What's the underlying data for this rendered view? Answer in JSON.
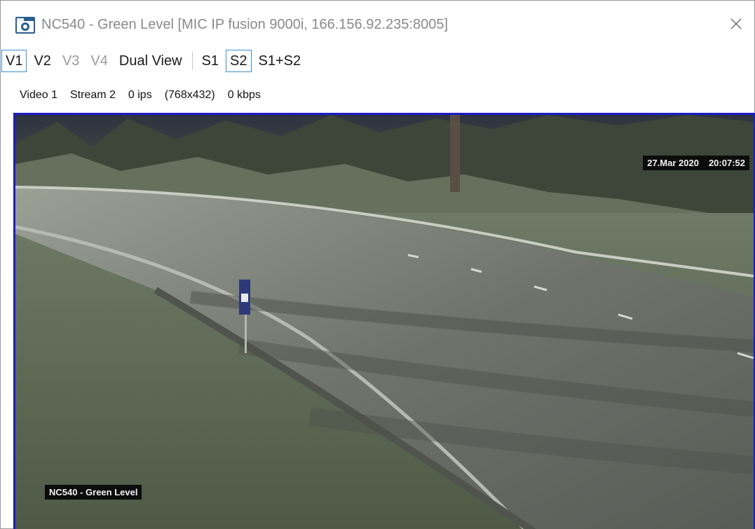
{
  "window": {
    "title": "NC540 - Green Level [MIC IP fusion 9000i, 166.156.92.235:8005]",
    "close_icon": "close-icon",
    "app_icon": "camera-icon"
  },
  "toolbar": {
    "items": [
      {
        "label": "V1",
        "selected": true,
        "enabled": true
      },
      {
        "label": "V2",
        "selected": false,
        "enabled": true
      },
      {
        "label": "V3",
        "selected": false,
        "enabled": false
      },
      {
        "label": "V4",
        "selected": false,
        "enabled": false
      },
      {
        "label": "Dual View",
        "selected": false,
        "enabled": true
      },
      {
        "label": "S1",
        "selected": false,
        "enabled": true
      },
      {
        "label": "S2",
        "selected": true,
        "enabled": true
      },
      {
        "label": "S1+S2",
        "selected": false,
        "enabled": true
      }
    ]
  },
  "status": {
    "video": "Video 1",
    "stream": "Stream 2",
    "fps": "0 ips",
    "resolution": "(768x432)",
    "bitrate": "0 kbps"
  },
  "video": {
    "date": "27.Mar 2020",
    "time": "20:07:52",
    "location_label": "NC540 - Green Level"
  },
  "colors": {
    "selection_border": "#3c8fd6",
    "video_border": "#1c1cc8",
    "disabled_text": "#9a9a9a"
  }
}
